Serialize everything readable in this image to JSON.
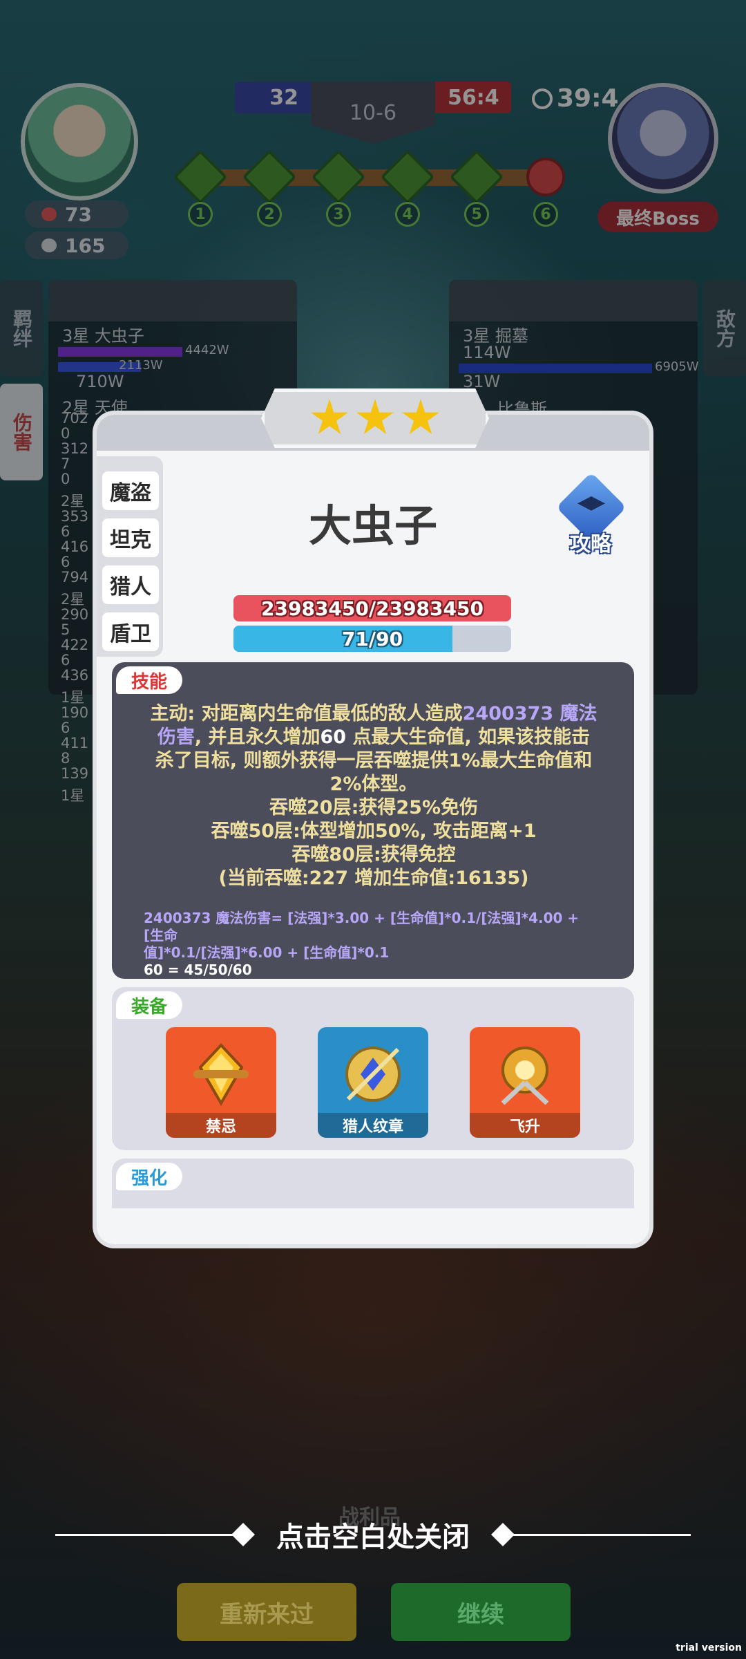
{
  "hud": {
    "hp": "73",
    "coins": "165",
    "score_left": "32",
    "round": "10-6",
    "score_right": "56:4",
    "timer": "39:4",
    "boss_label": "最终Boss",
    "stages": [
      "1",
      "2",
      "3",
      "4",
      "5",
      "6"
    ]
  },
  "side_tabs": {
    "left_top": "羁绊",
    "left_bottom": "伤害",
    "right_top": "敌方"
  },
  "left_panel": {
    "rows": [
      {
        "label": "3星 大虫子",
        "value_a": "4442W",
        "value_b": "2113W"
      },
      {
        "label": "710W"
      },
      {
        "label": "2星 天使"
      }
    ],
    "numbers": [
      "7020",
      "3127",
      "0",
      "2星",
      "3536",
      "4166",
      "794",
      "2星",
      "2905",
      "4226",
      "436",
      "1星",
      "1906",
      "4118",
      "139",
      "1星"
    ]
  },
  "right_panel": {
    "rows": [
      {
        "label": "3星 掘墓",
        "value_a": "114W",
        "value_b": "6905W"
      },
      {
        "label": "31W"
      },
      {
        "label": "比鲁斯"
      }
    ]
  },
  "modal": {
    "stars": 3,
    "class_tabs": [
      "魔盗",
      "坦克",
      "猎人",
      "盾卫"
    ],
    "hero_name": "大虫子",
    "guide_label": "攻略",
    "hp_text": "23983450/23983450",
    "mana_text": "71/90",
    "mana_fraction": 0.789,
    "skill": {
      "tag": "技能",
      "desc_1a": "主动: 对距离内生命值最低的敌人造成",
      "desc_1b": "2400373 魔法",
      "desc_2a": "伤害",
      "desc_2b": ", 并且永久增加",
      "desc_2c": "60",
      "desc_2d": " 点最大生命值, 如果该技能击",
      "desc_3": "杀了目标, 则额外获得一层吞噬提供1%最大生命值和",
      "desc_4": "2%体型。",
      "desc_5": "吞噬20层:获得25%免伤",
      "desc_6": "吞噬50层:体型增加50%, 攻击距离+1",
      "desc_7": "吞噬80层:获得免控",
      "desc_8": "(当前吞噬:227 增加生命值:16135)",
      "formula_1": "2400373 魔法伤害= [法强]*3.00 + [生命值]*0.1/[法强]*4.00 + [生命",
      "formula_2": "值]*0.1/[法强]*6.00 + [生命值]*0.1",
      "formula_3a": "60 = 45/50/",
      "formula_3b": "60"
    },
    "equipment": {
      "tag": "装备",
      "items": [
        {
          "name": "禁忌",
          "icon": "forbidden-crystal-icon",
          "color": "#f05a2a"
        },
        {
          "name": "猎人纹章",
          "icon": "hunter-emblem-icon",
          "color": "#2a8ec8"
        },
        {
          "name": "飞升",
          "icon": "ascension-orb-icon",
          "color": "#f05a2a"
        }
      ]
    },
    "enhance": {
      "tag": "强化"
    }
  },
  "bottom": {
    "loot_label": "战利品",
    "close_hint": "点击空白处关闭",
    "retry": "重新来过",
    "continue": "继续"
  },
  "watermark": "trial version",
  "colors": {
    "hp_red": "#e8535e",
    "mana_blue": "#38b6e6",
    "skill_tag": "#d83838",
    "equip_tag": "#3aa82a",
    "enhance_tag": "#2a9ad8",
    "skill_highlight": "#b8a6f8",
    "skill_text": "#f0e0a0"
  }
}
